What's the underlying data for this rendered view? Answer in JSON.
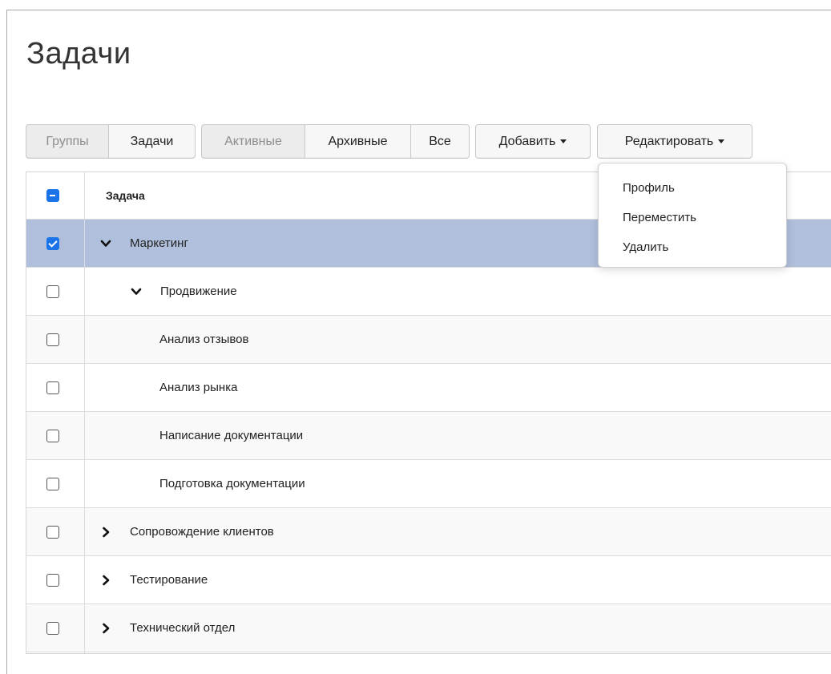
{
  "page": {
    "title": "Задачи"
  },
  "toolbar": {
    "view_group": [
      {
        "label": "Группы",
        "active": false
      },
      {
        "label": "Задачи",
        "active": true
      }
    ],
    "filter_group": [
      {
        "label": "Активные",
        "active": false
      },
      {
        "label": "Архивные",
        "active": true
      },
      {
        "label": "Все",
        "active": true
      }
    ],
    "add_label": "Добавить",
    "edit_label": "Редактировать"
  },
  "table": {
    "header": {
      "column": "Задача",
      "select_all_state": "indeterminate"
    },
    "rows": [
      {
        "label": "Маркетинг",
        "level": 0,
        "expander": "expanded",
        "checked": true,
        "selected": true
      },
      {
        "label": "Продвижение",
        "level": 1,
        "expander": "expanded",
        "checked": false,
        "selected": false
      },
      {
        "label": "Анализ отзывов",
        "level": 2,
        "expander": "none",
        "checked": false,
        "selected": false
      },
      {
        "label": "Анализ рынка",
        "level": 2,
        "expander": "none",
        "checked": false,
        "selected": false
      },
      {
        "label": "Написание документации",
        "level": 2,
        "expander": "none",
        "checked": false,
        "selected": false
      },
      {
        "label": "Подготовка документации",
        "level": 2,
        "expander": "none",
        "checked": false,
        "selected": false
      },
      {
        "label": "Сопровождение клиентов",
        "level": 0,
        "expander": "collapsed",
        "checked": false,
        "selected": false
      },
      {
        "label": "Тестирование",
        "level": 0,
        "expander": "collapsed",
        "checked": false,
        "selected": false
      },
      {
        "label": "Технический отдел",
        "level": 0,
        "expander": "collapsed",
        "checked": false,
        "selected": false
      }
    ]
  },
  "edit_menu": {
    "open": true,
    "items": [
      "Профиль",
      "Переместить",
      "Удалить"
    ]
  },
  "colors": {
    "selected_row": "#b0bfdb",
    "checkbox_accent": "#1a73e8"
  }
}
